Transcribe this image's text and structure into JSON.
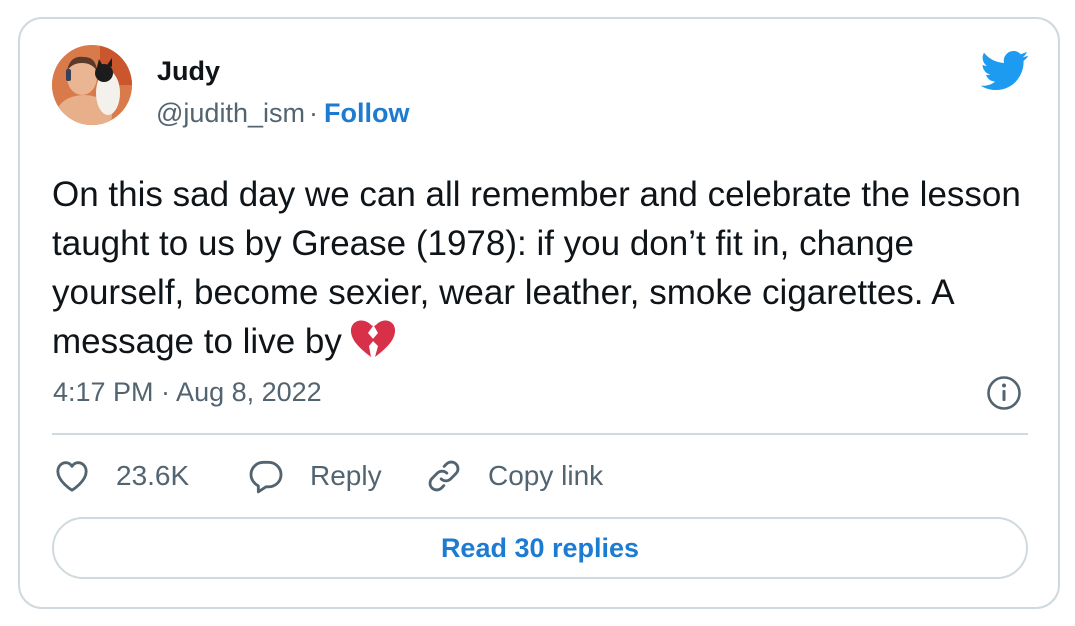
{
  "author": {
    "name": "Judy",
    "handle": "@judith_ism",
    "separator": "·",
    "follow_label": "Follow"
  },
  "tweet": {
    "text": "On this sad day we can all remember and celebrate the lesson taught to us by Grease (1978): if you don’t fit in, change yourself, become sexier, wear leather, smoke cigarettes. A message to live by",
    "emoji": "broken-heart",
    "timestamp": "4:17 PM · Aug 8, 2022"
  },
  "actions": {
    "like_count": "23.6K",
    "reply_label": "Reply",
    "copy_link_label": "Copy link"
  },
  "read_replies_label": "Read 30 replies",
  "colors": {
    "link_blue": "#1d7bd1",
    "twitter_blue": "#1d9bf0",
    "text_primary": "#0f1419",
    "text_secondary": "#536471",
    "border": "#cfd9de",
    "emoji_red": "#d9304a"
  },
  "icons": [
    "avatar-photo",
    "twitter-bird-icon",
    "broken-heart-emoji",
    "info-icon",
    "heart-icon",
    "reply-bubble-icon",
    "link-icon"
  ]
}
